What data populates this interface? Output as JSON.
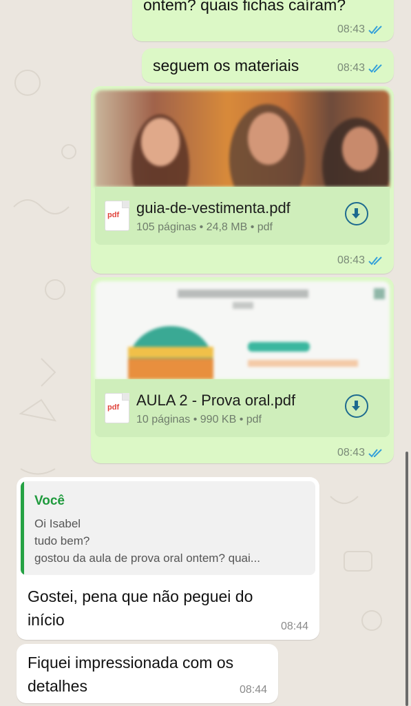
{
  "messages": [
    {
      "id": "m1",
      "text": "ontem? quais fichas caíram?",
      "time": "08:43"
    },
    {
      "id": "m2",
      "text": "seguem os materiais",
      "time": "08:43"
    }
  ],
  "documents": [
    {
      "name": "guia-de-vestimenta.pdf",
      "meta": "105 páginas • 24,8 MB • pdf",
      "icon_label": "pdf",
      "time": "08:43"
    },
    {
      "name": "AULA 2 - Prova oral.pdf",
      "meta": "10 páginas • 990 KB • pdf",
      "icon_label": "pdf",
      "time": "08:43"
    }
  ],
  "reply": {
    "author": "Você",
    "quoted_lines": [
      "Oi Isabel",
      "tudo bem?",
      "gostou da aula de prova oral ontem? quai..."
    ],
    "line1": "Gostei, pena que não peguei do",
    "line2": "início",
    "time": "08:44"
  },
  "incoming2": {
    "line1": "Fiquei impressionada com os",
    "line2": "detalhes",
    "time": "08:44"
  },
  "colors": {
    "outgoing": "#dcf8c6",
    "incoming": "#ffffff",
    "read_ticks": "#34a0d9",
    "accent_green": "#25a244"
  }
}
